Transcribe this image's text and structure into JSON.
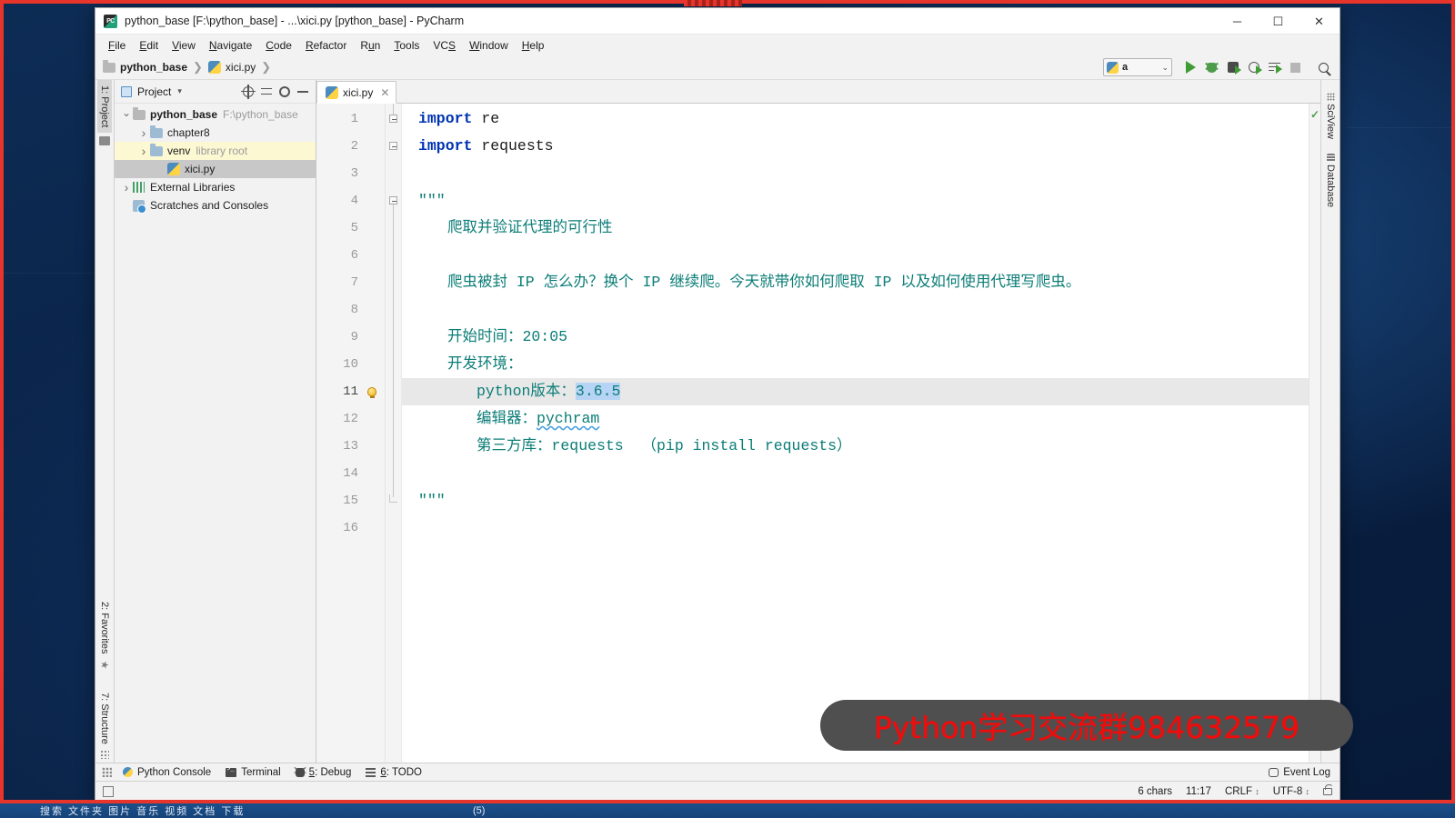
{
  "window": {
    "title": "python_base [F:\\python_base] - ...\\xici.py [python_base] - PyCharm",
    "logo_text": "PC",
    "minimize": "─",
    "maximize": "☐",
    "close": "✕"
  },
  "menu": [
    {
      "label": "File",
      "mnemonic": "F"
    },
    {
      "label": "Edit",
      "mnemonic": "E"
    },
    {
      "label": "View",
      "mnemonic": "V"
    },
    {
      "label": "Navigate",
      "mnemonic": "N"
    },
    {
      "label": "Code",
      "mnemonic": "C"
    },
    {
      "label": "Refactor",
      "mnemonic": "R"
    },
    {
      "label": "Run",
      "mnemonic": "u"
    },
    {
      "label": "Tools",
      "mnemonic": "T"
    },
    {
      "label": "VCS",
      "mnemonic": "S"
    },
    {
      "label": "Window",
      "mnemonic": "W"
    },
    {
      "label": "Help",
      "mnemonic": "H"
    }
  ],
  "breadcrumb": {
    "project": "python_base",
    "file": "xici.py",
    "separator": "❯"
  },
  "toolbar": {
    "run_config_name": "a",
    "chevron": "⌄",
    "icons": [
      "run-icon",
      "debug-icon",
      "coverage-icon",
      "profile-icon",
      "run-with-console-icon",
      "stop-icon",
      "search-everywhere-icon"
    ]
  },
  "left_strip": {
    "project_tab": "1: Project",
    "favorites_tab": "2: Favorites",
    "structure_tab": "7: Structure"
  },
  "right_strip": {
    "sciview_tab": "SciView",
    "database_tab": "Database"
  },
  "project_panel": {
    "title": "Project",
    "dropdown": "▾",
    "tree": [
      {
        "depth": 0,
        "arrow": "open",
        "icon": "folder-icon",
        "label": "python_base",
        "bold": true,
        "sub": "F:\\python_base",
        "state": "normal"
      },
      {
        "depth": 1,
        "arrow": "closed",
        "icon": "folder-icon",
        "label": "chapter8",
        "bold": false,
        "sub": "",
        "state": "normal"
      },
      {
        "depth": 1,
        "arrow": "closed",
        "icon": "folder-icon",
        "label": "venv",
        "bold": false,
        "sub": "library root",
        "state": "highlight"
      },
      {
        "depth": 2,
        "arrow": "none",
        "icon": "python-file-icon",
        "label": "xici.py",
        "bold": false,
        "sub": "",
        "state": "selected"
      },
      {
        "depth": 0,
        "arrow": "closed",
        "icon": "library-icon",
        "label": "External Libraries",
        "bold": false,
        "sub": "",
        "state": "normal"
      },
      {
        "depth": 0,
        "arrow": "none",
        "icon": "scratches-icon",
        "label": "Scratches and Consoles",
        "bold": false,
        "sub": "",
        "state": "normal"
      }
    ]
  },
  "editor": {
    "tab_label": "xici.py",
    "tab_close": "✕",
    "current_line": 11,
    "inspection_ok": "✓",
    "lines": [
      {
        "n": 1,
        "indent": 0,
        "segments": [
          {
            "t": "import",
            "c": "kw"
          },
          {
            "t": " re",
            "c": "plain"
          }
        ]
      },
      {
        "n": 2,
        "indent": 0,
        "segments": [
          {
            "t": "import",
            "c": "kw"
          },
          {
            "t": " requests",
            "c": "plain"
          }
        ]
      },
      {
        "n": 3,
        "indent": 0,
        "segments": []
      },
      {
        "n": 4,
        "indent": 0,
        "segments": [
          {
            "t": "\"\"\"",
            "c": "doc"
          }
        ]
      },
      {
        "n": 5,
        "indent": 2,
        "segments": [
          {
            "t": "爬取并验证代理的可行性",
            "c": "doc"
          }
        ]
      },
      {
        "n": 6,
        "indent": 0,
        "segments": []
      },
      {
        "n": 7,
        "indent": 2,
        "segments": [
          {
            "t": "爬虫被封 IP 怎么办？换个 IP 继续爬。今天就带你如何爬取 IP 以及如何使用代理写爬虫。",
            "c": "doc"
          }
        ]
      },
      {
        "n": 8,
        "indent": 0,
        "segments": []
      },
      {
        "n": 9,
        "indent": 2,
        "segments": [
          {
            "t": "开始时间：20:05",
            "c": "doc"
          }
        ]
      },
      {
        "n": 10,
        "indent": 2,
        "segments": [
          {
            "t": "开发环境：",
            "c": "doc"
          }
        ]
      },
      {
        "n": 11,
        "indent": 4,
        "segments": [
          {
            "t": "python版本：",
            "c": "doc"
          },
          {
            "t": "3.6.5",
            "c": "sel"
          }
        ]
      },
      {
        "n": 12,
        "indent": 4,
        "segments": [
          {
            "t": "编辑器：",
            "c": "doc"
          },
          {
            "t": "pychram",
            "c": "typo"
          }
        ]
      },
      {
        "n": 13,
        "indent": 4,
        "segments": [
          {
            "t": "第三方库：requests  （pip install requests）",
            "c": "doc"
          }
        ]
      },
      {
        "n": 14,
        "indent": 0,
        "segments": []
      },
      {
        "n": 15,
        "indent": 0,
        "segments": [
          {
            "t": "\"\"\"",
            "c": "doc"
          }
        ]
      },
      {
        "n": 16,
        "indent": 0,
        "segments": []
      }
    ]
  },
  "bottom_tabs": [
    {
      "label": "Python Console",
      "mnemonic": "",
      "icon": "python-console-icon"
    },
    {
      "label": "Terminal",
      "mnemonic": "",
      "icon": "terminal-icon"
    },
    {
      "label": "5: Debug",
      "mnemonic": "5",
      "icon": "debug-icon"
    },
    {
      "label": "6: TODO",
      "mnemonic": "6",
      "icon": "todo-icon"
    }
  ],
  "event_log": "Event Log",
  "status_bar": {
    "chars": "6 chars",
    "caret": "11:17",
    "line_separator": "CRLF",
    "encoding": "UTF-8",
    "spinner": "↕",
    "lock": "lock-icon"
  },
  "watermark": {
    "text": "Python学习交流群984632579",
    "color": "#f10c0c",
    "background": "#4f4f4f"
  },
  "taskbar": {
    "text": "搜索  文件夹  图片  音乐  视频  文档  下载",
    "center": "(5)"
  },
  "colors": {
    "accent_blue": "#2b6ca3",
    "doc_string": "#0b7d77",
    "keyword": "#0033b3",
    "selection": "#b6d4f5",
    "rec_border": "#e8352c"
  }
}
